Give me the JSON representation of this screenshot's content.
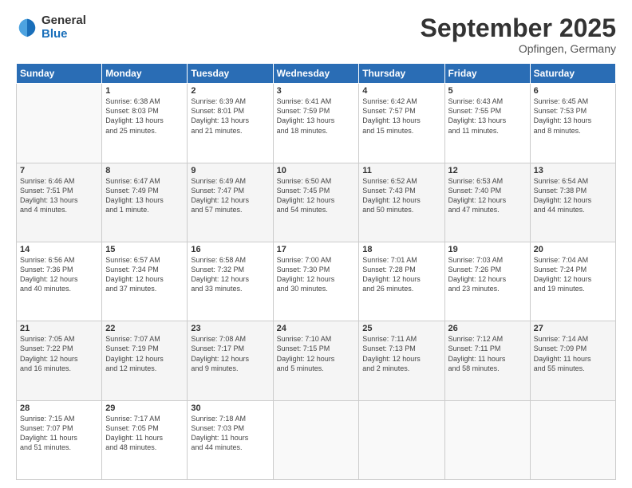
{
  "logo": {
    "general": "General",
    "blue": "Blue"
  },
  "header": {
    "month": "September 2025",
    "location": "Opfingen, Germany"
  },
  "weekdays": [
    "Sunday",
    "Monday",
    "Tuesday",
    "Wednesday",
    "Thursday",
    "Friday",
    "Saturday"
  ],
  "weeks": [
    [
      {
        "day": "",
        "info": ""
      },
      {
        "day": "1",
        "info": "Sunrise: 6:38 AM\nSunset: 8:03 PM\nDaylight: 13 hours\nand 25 minutes."
      },
      {
        "day": "2",
        "info": "Sunrise: 6:39 AM\nSunset: 8:01 PM\nDaylight: 13 hours\nand 21 minutes."
      },
      {
        "day": "3",
        "info": "Sunrise: 6:41 AM\nSunset: 7:59 PM\nDaylight: 13 hours\nand 18 minutes."
      },
      {
        "day": "4",
        "info": "Sunrise: 6:42 AM\nSunset: 7:57 PM\nDaylight: 13 hours\nand 15 minutes."
      },
      {
        "day": "5",
        "info": "Sunrise: 6:43 AM\nSunset: 7:55 PM\nDaylight: 13 hours\nand 11 minutes."
      },
      {
        "day": "6",
        "info": "Sunrise: 6:45 AM\nSunset: 7:53 PM\nDaylight: 13 hours\nand 8 minutes."
      }
    ],
    [
      {
        "day": "7",
        "info": "Sunrise: 6:46 AM\nSunset: 7:51 PM\nDaylight: 13 hours\nand 4 minutes."
      },
      {
        "day": "8",
        "info": "Sunrise: 6:47 AM\nSunset: 7:49 PM\nDaylight: 13 hours\nand 1 minute."
      },
      {
        "day": "9",
        "info": "Sunrise: 6:49 AM\nSunset: 7:47 PM\nDaylight: 12 hours\nand 57 minutes."
      },
      {
        "day": "10",
        "info": "Sunrise: 6:50 AM\nSunset: 7:45 PM\nDaylight: 12 hours\nand 54 minutes."
      },
      {
        "day": "11",
        "info": "Sunrise: 6:52 AM\nSunset: 7:43 PM\nDaylight: 12 hours\nand 50 minutes."
      },
      {
        "day": "12",
        "info": "Sunrise: 6:53 AM\nSunset: 7:40 PM\nDaylight: 12 hours\nand 47 minutes."
      },
      {
        "day": "13",
        "info": "Sunrise: 6:54 AM\nSunset: 7:38 PM\nDaylight: 12 hours\nand 44 minutes."
      }
    ],
    [
      {
        "day": "14",
        "info": "Sunrise: 6:56 AM\nSunset: 7:36 PM\nDaylight: 12 hours\nand 40 minutes."
      },
      {
        "day": "15",
        "info": "Sunrise: 6:57 AM\nSunset: 7:34 PM\nDaylight: 12 hours\nand 37 minutes."
      },
      {
        "day": "16",
        "info": "Sunrise: 6:58 AM\nSunset: 7:32 PM\nDaylight: 12 hours\nand 33 minutes."
      },
      {
        "day": "17",
        "info": "Sunrise: 7:00 AM\nSunset: 7:30 PM\nDaylight: 12 hours\nand 30 minutes."
      },
      {
        "day": "18",
        "info": "Sunrise: 7:01 AM\nSunset: 7:28 PM\nDaylight: 12 hours\nand 26 minutes."
      },
      {
        "day": "19",
        "info": "Sunrise: 7:03 AM\nSunset: 7:26 PM\nDaylight: 12 hours\nand 23 minutes."
      },
      {
        "day": "20",
        "info": "Sunrise: 7:04 AM\nSunset: 7:24 PM\nDaylight: 12 hours\nand 19 minutes."
      }
    ],
    [
      {
        "day": "21",
        "info": "Sunrise: 7:05 AM\nSunset: 7:22 PM\nDaylight: 12 hours\nand 16 minutes."
      },
      {
        "day": "22",
        "info": "Sunrise: 7:07 AM\nSunset: 7:19 PM\nDaylight: 12 hours\nand 12 minutes."
      },
      {
        "day": "23",
        "info": "Sunrise: 7:08 AM\nSunset: 7:17 PM\nDaylight: 12 hours\nand 9 minutes."
      },
      {
        "day": "24",
        "info": "Sunrise: 7:10 AM\nSunset: 7:15 PM\nDaylight: 12 hours\nand 5 minutes."
      },
      {
        "day": "25",
        "info": "Sunrise: 7:11 AM\nSunset: 7:13 PM\nDaylight: 12 hours\nand 2 minutes."
      },
      {
        "day": "26",
        "info": "Sunrise: 7:12 AM\nSunset: 7:11 PM\nDaylight: 11 hours\nand 58 minutes."
      },
      {
        "day": "27",
        "info": "Sunrise: 7:14 AM\nSunset: 7:09 PM\nDaylight: 11 hours\nand 55 minutes."
      }
    ],
    [
      {
        "day": "28",
        "info": "Sunrise: 7:15 AM\nSunset: 7:07 PM\nDaylight: 11 hours\nand 51 minutes."
      },
      {
        "day": "29",
        "info": "Sunrise: 7:17 AM\nSunset: 7:05 PM\nDaylight: 11 hours\nand 48 minutes."
      },
      {
        "day": "30",
        "info": "Sunrise: 7:18 AM\nSunset: 7:03 PM\nDaylight: 11 hours\nand 44 minutes."
      },
      {
        "day": "",
        "info": ""
      },
      {
        "day": "",
        "info": ""
      },
      {
        "day": "",
        "info": ""
      },
      {
        "day": "",
        "info": ""
      }
    ]
  ]
}
